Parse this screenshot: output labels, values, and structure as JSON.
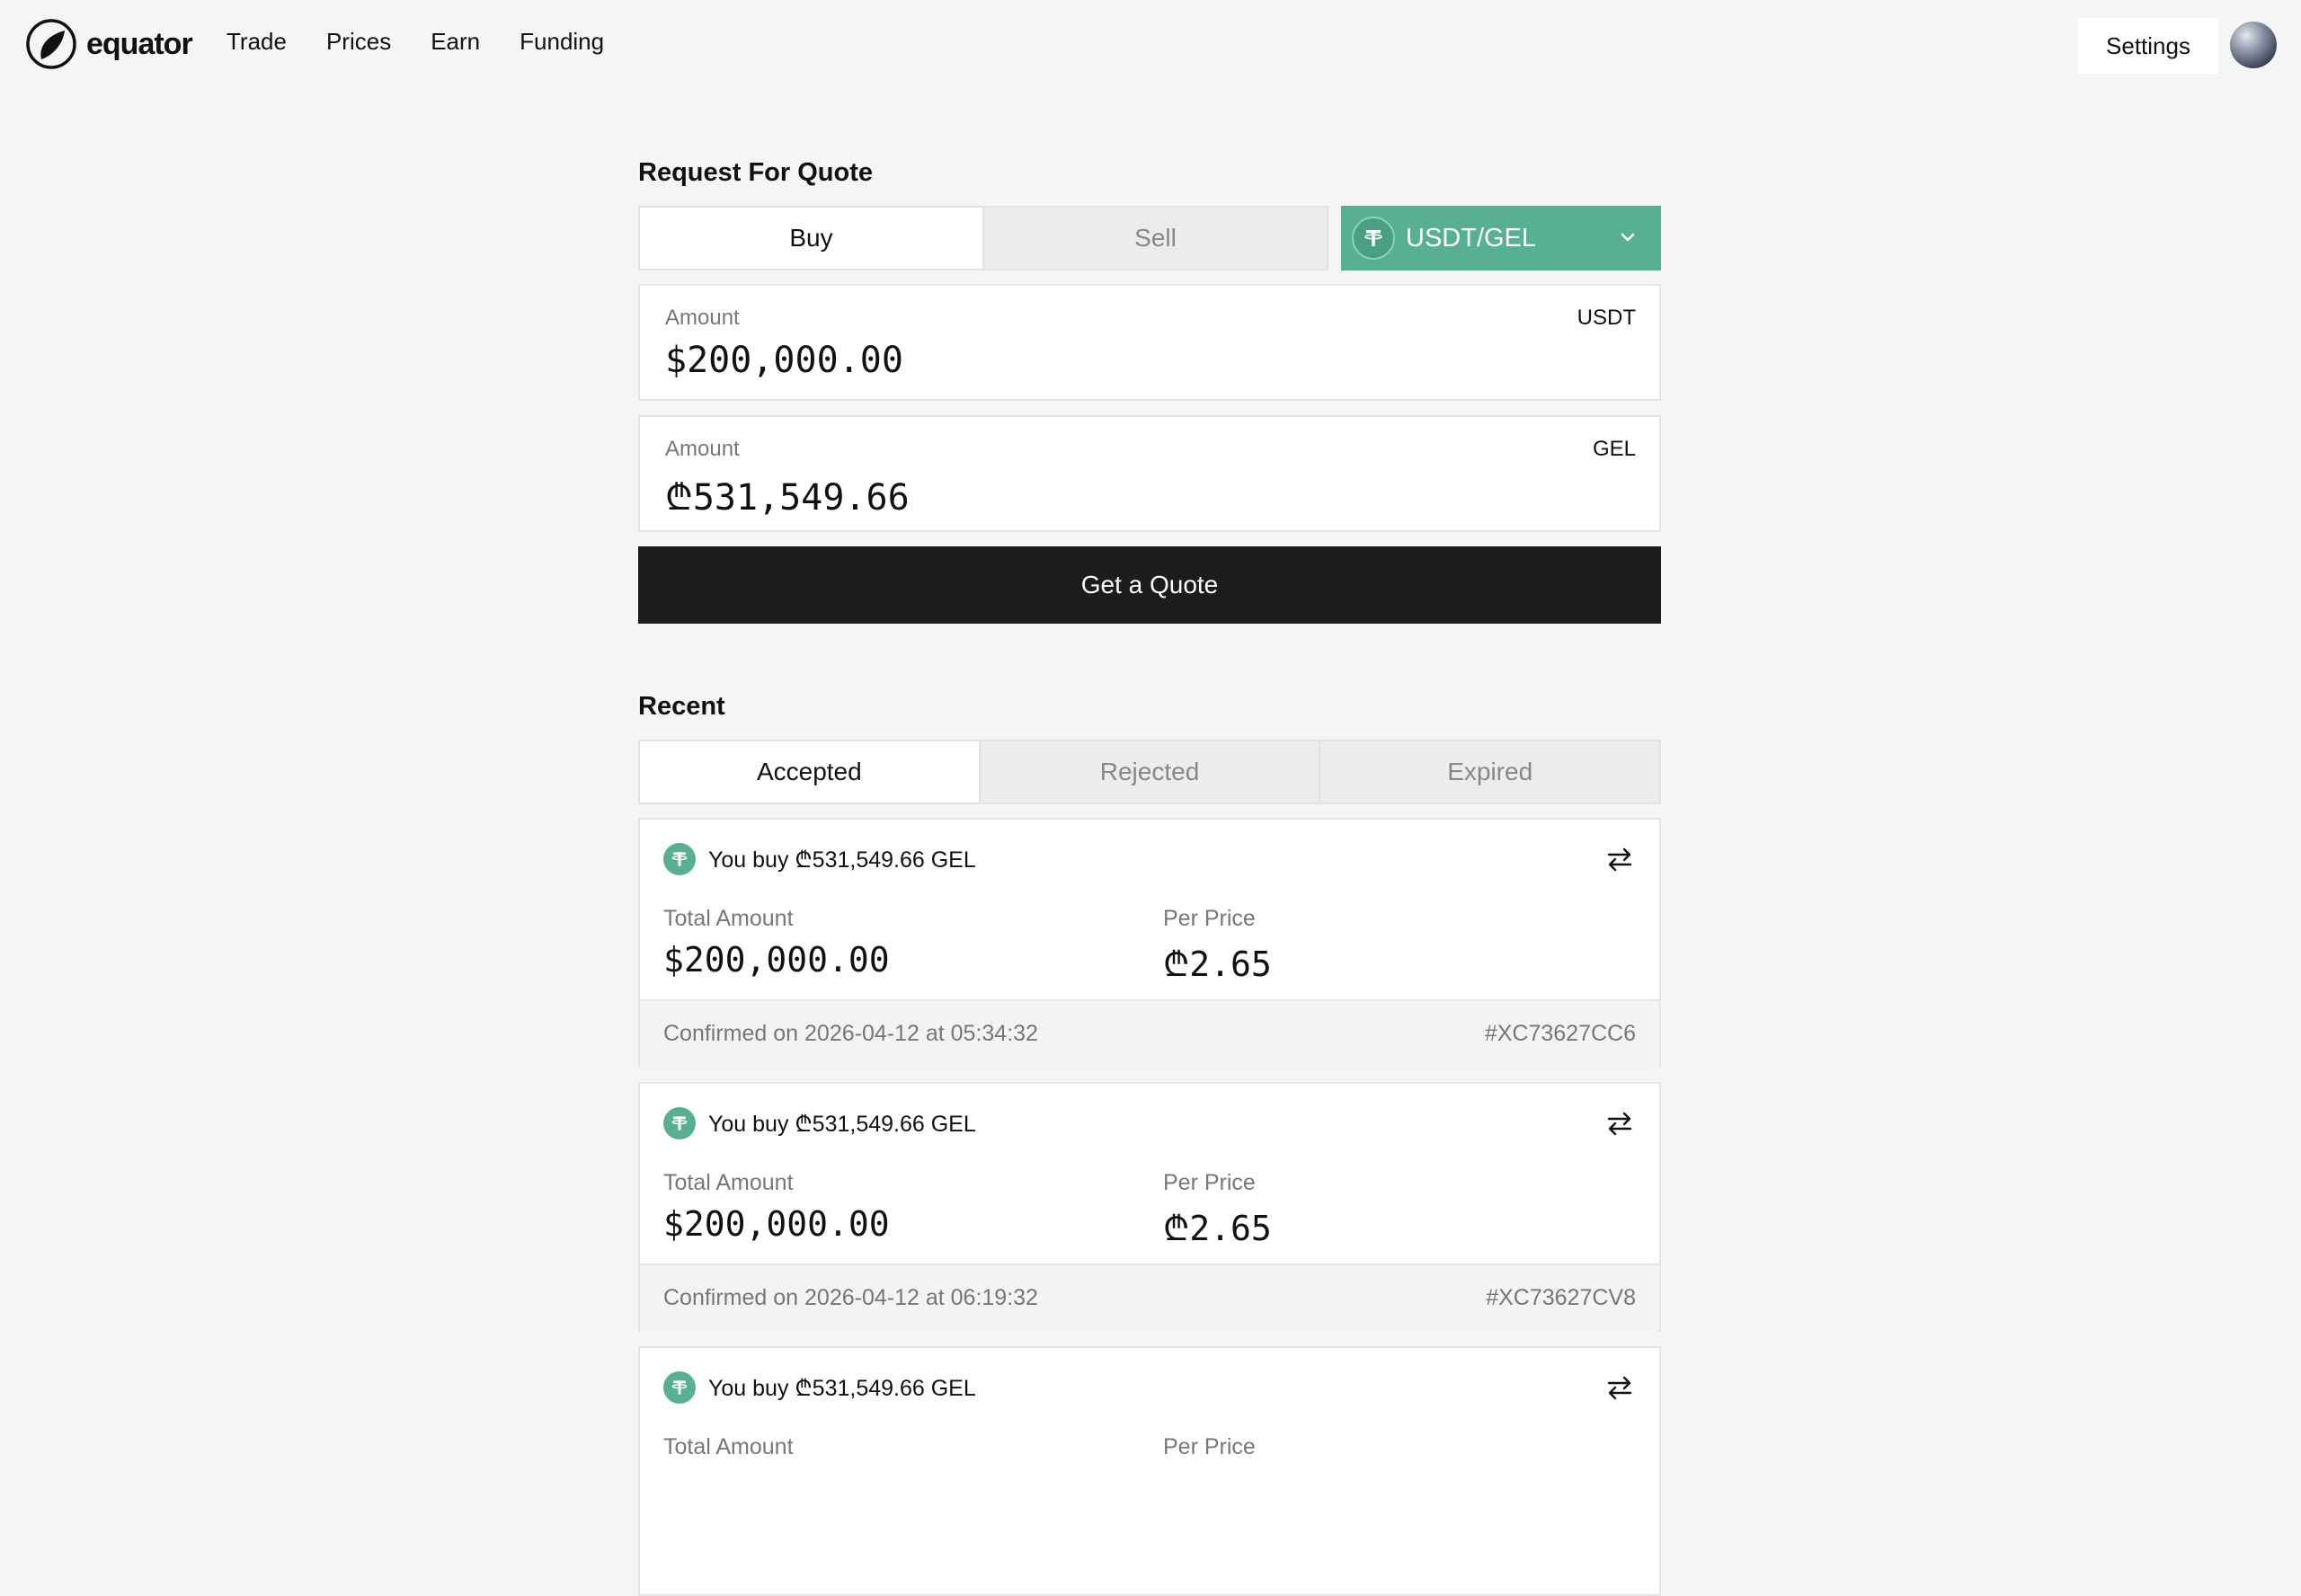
{
  "brand": {
    "name": "equator"
  },
  "nav": [
    "Trade",
    "Prices",
    "Earn",
    "Funding"
  ],
  "header": {
    "settings_label": "Settings"
  },
  "rfq": {
    "title": "Request For Quote",
    "side_options": [
      "Buy",
      "Sell"
    ],
    "selected_side": "Buy",
    "pair": "USDT/GEL",
    "amount_base": {
      "label": "Amount",
      "currency": "USDT",
      "value": "$200,000.00"
    },
    "amount_quote": {
      "label": "Amount",
      "currency": "GEL",
      "value": "₾531,549.66"
    },
    "submit_label": "Get a Quote"
  },
  "recent": {
    "title": "Recent",
    "tabs": [
      "Accepted",
      "Rejected",
      "Expired"
    ],
    "active_tab": "Accepted",
    "total_label": "Total Amount",
    "price_label": "Per Price",
    "items": [
      {
        "title": "You buy ₾531,549.66 GEL",
        "total": "$200,000.00",
        "price": "₾2.65",
        "confirmed": "Confirmed on 2026-04-12 at 05:34:32",
        "id": "#XC73627CC6"
      },
      {
        "title": "You buy ₾531,549.66 GEL",
        "total": "$200,000.00",
        "price": "₾2.65",
        "confirmed": "Confirmed on 2026-04-12 at 06:19:32",
        "id": "#XC73627CV8"
      },
      {
        "title": "You buy ₾531,549.66 GEL",
        "total": "",
        "price": "",
        "confirmed": "",
        "id": ""
      }
    ]
  },
  "colors": {
    "accent": "#57b093",
    "button_dark": "#1c1c1c",
    "background": "#f5f5f5"
  },
  "icons": [
    "equator-logo",
    "tether-icon",
    "chevron-down-icon",
    "swap-arrows-icon",
    "avatar"
  ]
}
